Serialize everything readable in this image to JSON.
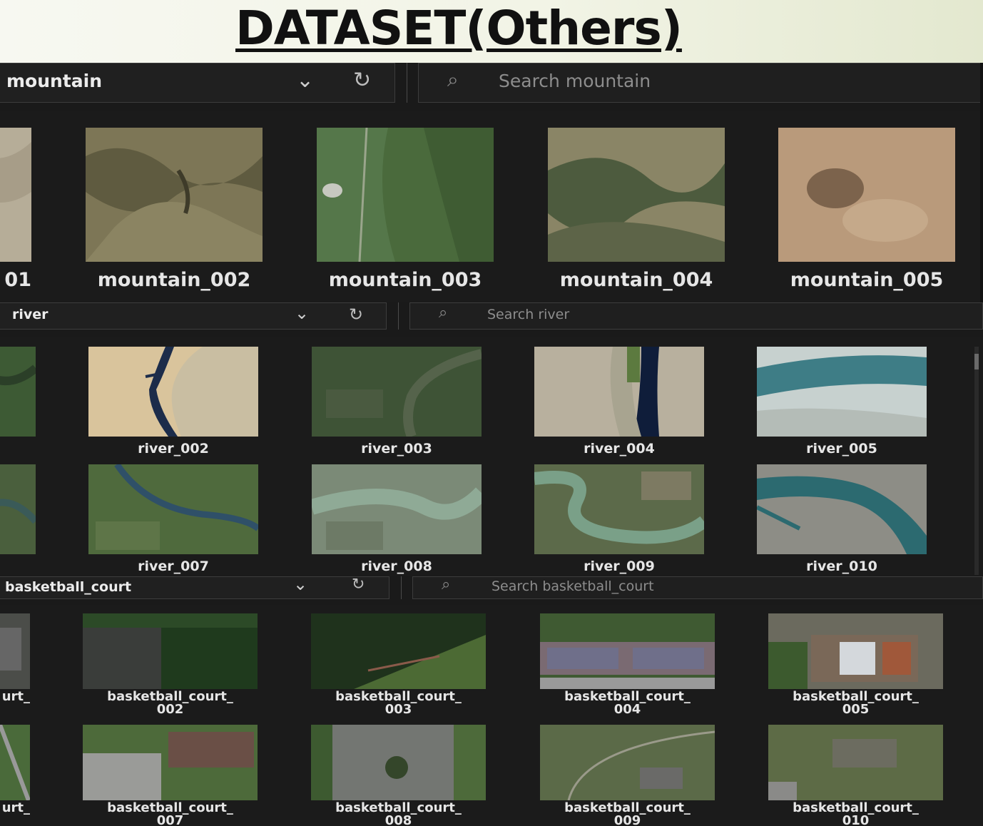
{
  "title": "DATASET(Others)",
  "mountain": {
    "category": "mountain",
    "search_placeholder": "Search mountain",
    "items": [
      "01",
      "mountain_002",
      "mountain_003",
      "mountain_004",
      "mountain_005"
    ]
  },
  "river": {
    "category": "river",
    "search_placeholder": "Search river",
    "row1": [
      "",
      "river_002",
      "river_003",
      "river_004",
      "river_005"
    ],
    "row2": [
      "",
      "river_007",
      "river_008",
      "river_009",
      "river_010"
    ]
  },
  "basketball": {
    "category": "basketball_court",
    "search_placeholder": "Search basketball_court",
    "row1": [
      {
        "l1": "urt_",
        "l2": ""
      },
      {
        "l1": "basketball_court_",
        "l2": "002"
      },
      {
        "l1": "basketball_court_",
        "l2": "003"
      },
      {
        "l1": "basketball_court_",
        "l2": "004"
      },
      {
        "l1": "basketball_court_",
        "l2": "005"
      }
    ],
    "row2": [
      {
        "l1": "urt_",
        "l2": ""
      },
      {
        "l1": "basketball_court_",
        "l2": "007"
      },
      {
        "l1": "basketball_court_",
        "l2": "008"
      },
      {
        "l1": "basketball_court_",
        "l2": "009"
      },
      {
        "l1": "basketball_court_",
        "l2": "010"
      }
    ]
  },
  "icons": {
    "dropdown": "chevron-down-icon",
    "refresh": "refresh-icon",
    "search": "search-icon"
  },
  "colors": {
    "background": "#1b1b1b",
    "title_bar": "#f2f4e6",
    "text": "#e6e6e6",
    "placeholder": "#8d8d8d"
  }
}
